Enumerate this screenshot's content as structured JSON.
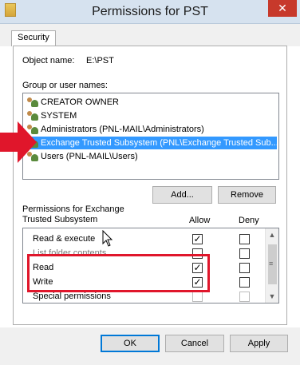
{
  "window": {
    "title": "Permissions for PST",
    "close_glyph": "✕"
  },
  "tabs": [
    {
      "label": "Security"
    }
  ],
  "object": {
    "label": "Object name:",
    "value": "E:\\PST"
  },
  "groups": {
    "label": "Group or user names:",
    "users": [
      {
        "name": "CREATOR OWNER",
        "icon": "users-icon",
        "selected": false
      },
      {
        "name": "SYSTEM",
        "icon": "users-icon",
        "selected": false
      },
      {
        "name": "Administrators (PNL-MAIL\\Administrators)",
        "icon": "users-icon",
        "selected": false
      },
      {
        "name": "Exchange Trusted Subsystem (PNL\\Exchange Trusted Sub...",
        "icon": "users-icon",
        "selected": true
      },
      {
        "name": "Users (PNL-MAIL\\Users)",
        "icon": "users-icon",
        "selected": false
      }
    ],
    "add_label": "Add...",
    "remove_label": "Remove"
  },
  "permissions": {
    "label_line1": "Permissions for Exchange",
    "label_line2": "Trusted Subsystem",
    "allow_header": "Allow",
    "deny_header": "Deny",
    "rows": [
      {
        "name": "Read & execute",
        "allow": true,
        "deny": false,
        "disabled": false
      },
      {
        "name": "List folder contents",
        "allow": false,
        "deny": false,
        "disabled": false
      },
      {
        "name": "Read",
        "allow": true,
        "deny": false,
        "disabled": false
      },
      {
        "name": "Write",
        "allow": true,
        "deny": false,
        "disabled": false
      },
      {
        "name": "Special permissions",
        "allow": false,
        "deny": false,
        "disabled": true
      }
    ]
  },
  "footer": {
    "ok_label": "OK",
    "cancel_label": "Cancel",
    "apply_label": "Apply"
  },
  "colors": {
    "highlight": "#e0162b",
    "selection": "#3399ff"
  }
}
